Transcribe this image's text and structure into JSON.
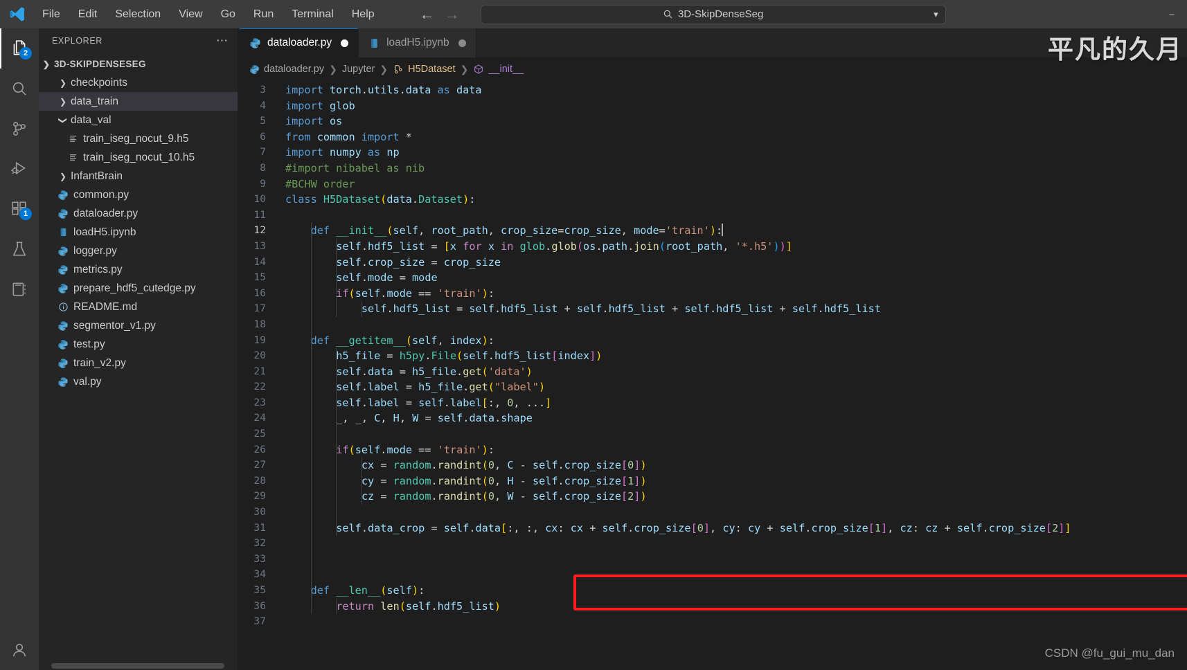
{
  "titlebar": {
    "logo_icon": "vscode-logo-icon",
    "menus": [
      "File",
      "Edit",
      "Selection",
      "View",
      "Go",
      "Run",
      "Terminal",
      "Help"
    ],
    "back_icon": "arrow-left-icon",
    "forward_icon": "arrow-right-icon",
    "command_center": {
      "search_icon": "search-icon",
      "text": "3D-SkipDenseSeg",
      "chevron_icon": "chevron-down-icon"
    },
    "window_controls": [
      "minimize",
      "maximize",
      "close"
    ]
  },
  "activitybar": {
    "items": [
      {
        "name": "explorer",
        "icon": "files-icon",
        "badge": "2",
        "active": true
      },
      {
        "name": "search",
        "icon": "search-icon",
        "badge": "",
        "active": false
      },
      {
        "name": "source-control",
        "icon": "source-control-icon",
        "badge": "",
        "active": false
      },
      {
        "name": "run-and-debug",
        "icon": "run-debug-icon",
        "badge": "",
        "active": false
      },
      {
        "name": "extensions",
        "icon": "extensions-icon",
        "badge": "1",
        "active": false
      },
      {
        "name": "testing",
        "icon": "beaker-icon",
        "badge": "",
        "active": false
      },
      {
        "name": "jupyter",
        "icon": "notebook-icon",
        "badge": "",
        "active": false
      }
    ],
    "bottom": [
      {
        "name": "accounts",
        "icon": "account-icon"
      }
    ]
  },
  "sidebar": {
    "title": "EXPLORER",
    "actions_icon": "more-actions-icon",
    "root": {
      "label": "3D-SKIPDENSESEG",
      "expanded": true
    },
    "tree": [
      {
        "label": "checkpoints",
        "type": "folder",
        "expanded": false,
        "depth": 1,
        "selected": false
      },
      {
        "label": "data_train",
        "type": "folder",
        "expanded": false,
        "depth": 1,
        "selected": true
      },
      {
        "label": "data_val",
        "type": "folder",
        "expanded": true,
        "depth": 1,
        "selected": false
      },
      {
        "label": "train_iseg_nocut_9.h5",
        "type": "h5",
        "expanded": null,
        "depth": 2,
        "selected": false
      },
      {
        "label": "train_iseg_nocut_10.h5",
        "type": "h5",
        "expanded": null,
        "depth": 2,
        "selected": false
      },
      {
        "label": "InfantBrain",
        "type": "folder",
        "expanded": false,
        "depth": 1,
        "selected": false
      },
      {
        "label": "common.py",
        "type": "python",
        "expanded": null,
        "depth": 1,
        "selected": false
      },
      {
        "label": "dataloader.py",
        "type": "python",
        "expanded": null,
        "depth": 1,
        "selected": false
      },
      {
        "label": "loadH5.ipynb",
        "type": "notebook",
        "expanded": null,
        "depth": 1,
        "selected": false
      },
      {
        "label": "logger.py",
        "type": "python",
        "expanded": null,
        "depth": 1,
        "selected": false
      },
      {
        "label": "metrics.py",
        "type": "python",
        "expanded": null,
        "depth": 1,
        "selected": false
      },
      {
        "label": "prepare_hdf5_cutedge.py",
        "type": "python",
        "expanded": null,
        "depth": 1,
        "selected": false
      },
      {
        "label": "README.md",
        "type": "markdown",
        "expanded": null,
        "depth": 1,
        "selected": false
      },
      {
        "label": "segmentor_v1.py",
        "type": "python",
        "expanded": null,
        "depth": 1,
        "selected": false
      },
      {
        "label": "test.py",
        "type": "python",
        "expanded": null,
        "depth": 1,
        "selected": false
      },
      {
        "label": "train_v2.py",
        "type": "python",
        "expanded": null,
        "depth": 1,
        "selected": false
      },
      {
        "label": "val.py",
        "type": "python",
        "expanded": null,
        "depth": 1,
        "selected": false
      }
    ]
  },
  "editor": {
    "tabs": [
      {
        "label": "dataloader.py",
        "icon": "python-icon",
        "active": true,
        "dirty": true
      },
      {
        "label": "loadH5.ipynb",
        "icon": "notebook-icon",
        "active": false,
        "dirty": true
      }
    ],
    "breadcrumbs": [
      {
        "label": "dataloader.py",
        "icon": "python-icon"
      },
      {
        "label": "Jupyter",
        "icon": ""
      },
      {
        "label": "H5Dataset",
        "icon": "class-icon"
      },
      {
        "label": "__init__",
        "icon": "method-icon"
      }
    ],
    "first_visible_line": 3,
    "cursor_line": 12,
    "lines": [
      {
        "n": 3,
        "text": "import torch.utils.data as data"
      },
      {
        "n": 4,
        "text": "import glob"
      },
      {
        "n": 5,
        "text": "import os"
      },
      {
        "n": 6,
        "text": "from common import *"
      },
      {
        "n": 7,
        "text": "import numpy as np"
      },
      {
        "n": 8,
        "text": "#import nibabel as nib"
      },
      {
        "n": 9,
        "text": "#BCHW order"
      },
      {
        "n": 10,
        "text": "class H5Dataset(data.Dataset):"
      },
      {
        "n": 11,
        "text": ""
      },
      {
        "n": 12,
        "text": "    def __init__(self, root_path, crop_size=crop_size, mode='train'):"
      },
      {
        "n": 13,
        "text": "        self.hdf5_list = [x for x in glob.glob(os.path.join(root_path, '*.h5'))]"
      },
      {
        "n": 14,
        "text": "        self.crop_size = crop_size"
      },
      {
        "n": 15,
        "text": "        self.mode = mode"
      },
      {
        "n": 16,
        "text": "        if(self.mode == 'train'):"
      },
      {
        "n": 17,
        "text": "            self.hdf5_list = self.hdf5_list + self.hdf5_list + self.hdf5_list + self.hdf5_list"
      },
      {
        "n": 18,
        "text": ""
      },
      {
        "n": 19,
        "text": "    def __getitem__(self, index):"
      },
      {
        "n": 20,
        "text": "        h5_file = h5py.File(self.hdf5_list[index])"
      },
      {
        "n": 21,
        "text": "        self.data = h5_file.get('data')"
      },
      {
        "n": 22,
        "text": "        self.label = h5_file.get(\"label\")"
      },
      {
        "n": 23,
        "text": "        self.label = self.label[:, 0, ...]"
      },
      {
        "n": 24,
        "text": "        _, _, C, H, W = self.data.shape"
      },
      {
        "n": 25,
        "text": ""
      },
      {
        "n": 26,
        "text": "        if(self.mode == 'train'):"
      },
      {
        "n": 27,
        "text": "            cx = random.randint(0, C - self.crop_size[0])"
      },
      {
        "n": 28,
        "text": "            cy = random.randint(0, H - self.crop_size[1])"
      },
      {
        "n": 29,
        "text": "            cz = random.randint(0, W - self.crop_size[2])"
      },
      {
        "n": 30,
        "text": ""
      },
      {
        "n": 31,
        "text": "        self.data_crop = self.data[:, :, cx: cx + self.crop_size[0], cy: cy + self.crop_size[1], cz: cz + self.crop_size[2]]"
      },
      {
        "n": 32,
        "text": ""
      },
      {
        "n": 33,
        "text": ""
      },
      {
        "n": 34,
        "text": ""
      },
      {
        "n": 35,
        "text": "    def __len__(self):"
      },
      {
        "n": 36,
        "text": "        return len(self.hdf5_list)"
      },
      {
        "n": 37,
        "text": ""
      }
    ],
    "highlight": {
      "line": 31,
      "color": "#fc1c1c"
    }
  },
  "watermarks": {
    "top_right_cn": "平凡的久月",
    "bottom_right": "CSDN @fu_gui_mu_dan"
  },
  "colors": {
    "accent": "#0078d4",
    "editor_bg": "#1e1e1e",
    "sidebar_bg": "#252526",
    "activitybar_bg": "#333333",
    "titlebar_bg": "#3c3c3c",
    "highlight": "#fc1c1c"
  }
}
